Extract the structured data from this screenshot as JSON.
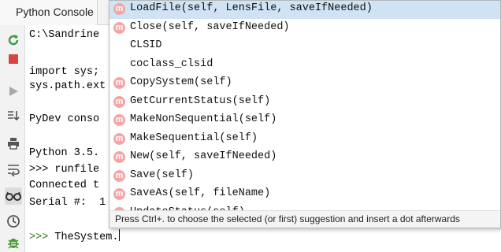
{
  "tab": {
    "label": "Python Console"
  },
  "toolbar": {
    "buttons": [
      {
        "name": "rerun-icon",
        "color": "#3a9a3a"
      },
      {
        "name": "stop-icon",
        "color": "#d94444"
      },
      {
        "name": "execute-icon",
        "color": "#9a9a9a"
      },
      {
        "name": "scroll-to-end-icon",
        "color": "#555555"
      },
      {
        "name": "print-icon",
        "color": "#555555"
      },
      {
        "name": "soft-wrap-icon",
        "color": "#555555"
      },
      {
        "name": "show-variables-icon",
        "color": "#333333"
      },
      {
        "name": "history-icon",
        "color": "#555555"
      },
      {
        "name": "debug-icon",
        "color": "#4a9a3a"
      }
    ]
  },
  "console": {
    "lines": [
      "C:\\Sandrine",
      "",
      "import sys;",
      "sys.path.ext",
      "",
      "PyDev conso",
      "",
      "Python 3.5.",
      ">>> runfile",
      "Connected t",
      "Serial #:  1"
    ],
    "prompt": ">>>",
    "input": "TheSystem."
  },
  "autocomplete": {
    "icon_letter": "m",
    "items": [
      {
        "text": "LoadFile(self, LensFile, saveIfNeeded)",
        "icon": true,
        "selected": true
      },
      {
        "text": "Close(self, saveIfNeeded)",
        "icon": true,
        "selected": false
      },
      {
        "text": "CLSID",
        "icon": false,
        "selected": false
      },
      {
        "text": "coclass_clsid",
        "icon": false,
        "selected": false
      },
      {
        "text": "CopySystem(self)",
        "icon": true,
        "selected": false
      },
      {
        "text": "GetCurrentStatus(self)",
        "icon": true,
        "selected": false
      },
      {
        "text": "MakeNonSequential(self)",
        "icon": true,
        "selected": false
      },
      {
        "text": "MakeSequential(self)",
        "icon": true,
        "selected": false
      },
      {
        "text": "New(self, saveIfNeeded)",
        "icon": true,
        "selected": false
      },
      {
        "text": "Save(self)",
        "icon": true,
        "selected": false
      },
      {
        "text": "SaveAs(self, fileName)",
        "icon": true,
        "selected": false
      },
      {
        "text": "UpdateStatus(self)",
        "icon": true,
        "selected": false
      }
    ],
    "hint": "Press Ctrl+. to choose the selected (or first) suggestion and insert a dot afterwards"
  }
}
